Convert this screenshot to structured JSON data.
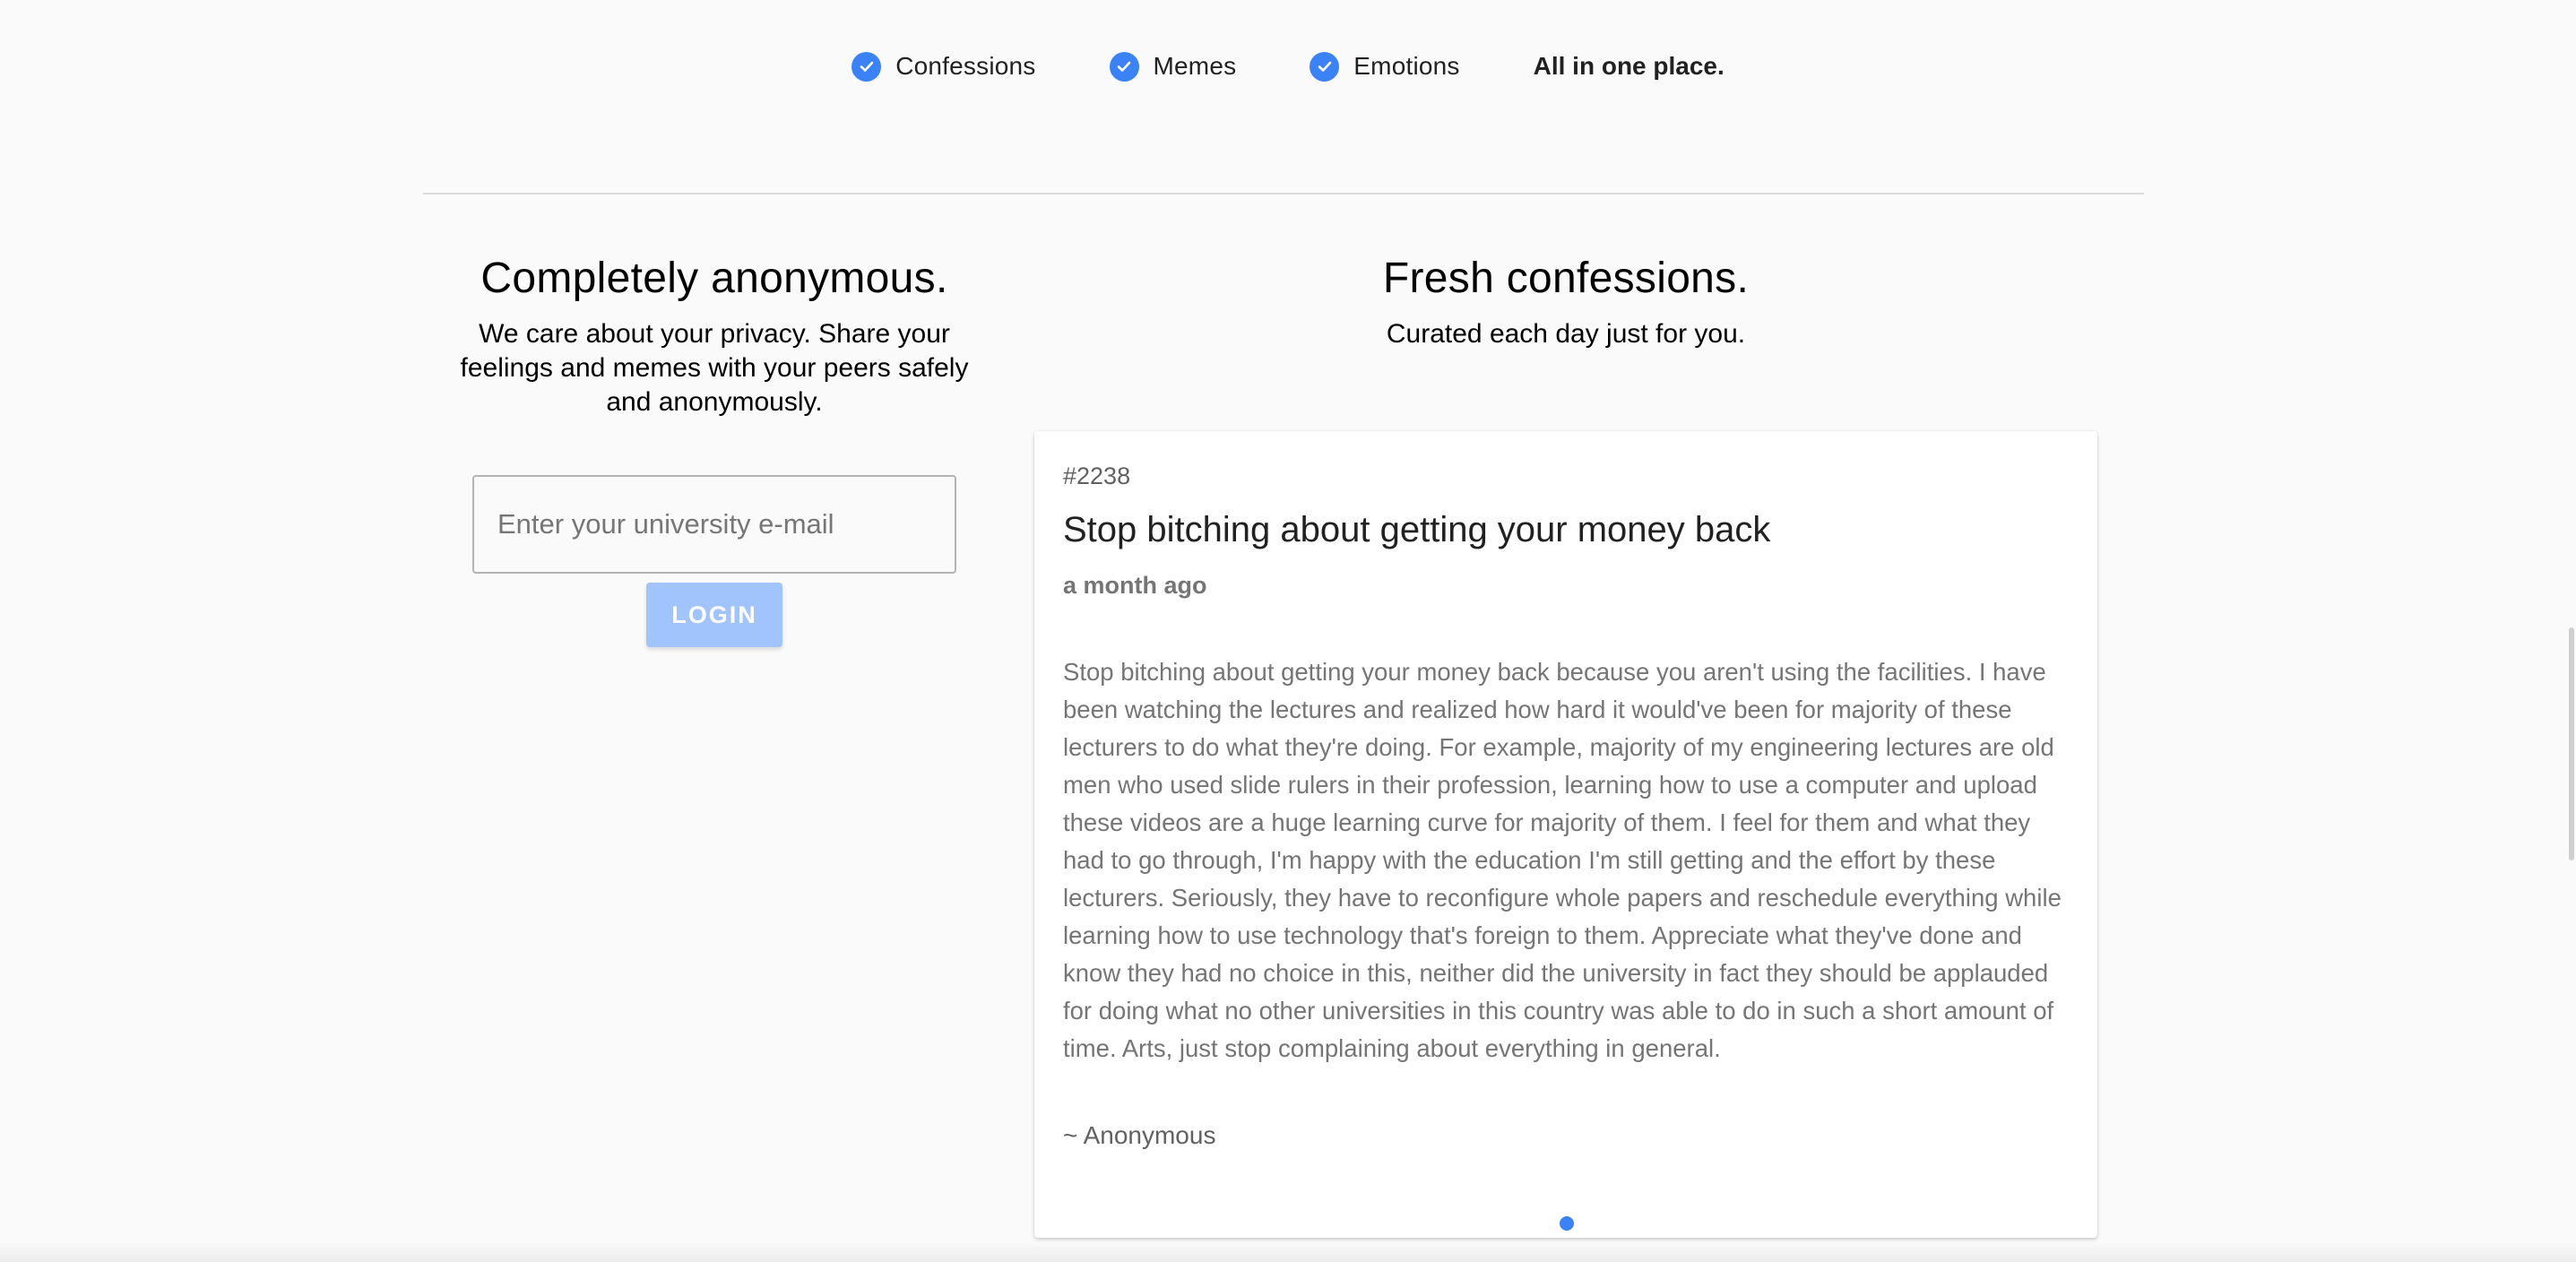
{
  "colors": {
    "accent": "#3b82f6",
    "button_disabled": "#a0c4fb",
    "background": "#fafafa"
  },
  "features": {
    "items": [
      {
        "label": "Confessions",
        "icon": "check-circle-icon"
      },
      {
        "label": "Memes",
        "icon": "check-circle-icon"
      },
      {
        "label": "Emotions",
        "icon": "check-circle-icon"
      }
    ],
    "tagline": "All in one place."
  },
  "left": {
    "title": "Completely anonymous.",
    "subtitle": "We care about your privacy. Share your feelings and memes with your peers safely and anonymously.",
    "email_placeholder": "Enter your university e-mail",
    "login_label": "LOGIN"
  },
  "right": {
    "title": "Fresh confessions.",
    "subtitle": "Curated each day just for you."
  },
  "confession": {
    "number": "#2238",
    "title": "Stop bitching about getting your money back",
    "time": "a month ago",
    "body": "Stop bitching about getting your money back because you aren't using the facilities. I have been watching the lectures and realized how hard it would've been for majority of these lecturers to do what they're doing. For example, majority of my engineering lectures are old men who used slide rulers in their profession, learning how to use a computer and upload these videos are a huge learning curve for majority of them. I feel for them and what they had to go through, I'm happy with the education I'm still getting and the effort by these lecturers. Seriously, they have to reconfigure whole papers and reschedule everything while learning how to use technology that's foreign to them. Appreciate what they've done and know they had no choice in this, neither did the university in fact they should be applauded for doing what no other universities in this country was able to do in such a short amount of time. Arts, just stop complaining about everything in general.",
    "author": "~ Anonymous"
  }
}
